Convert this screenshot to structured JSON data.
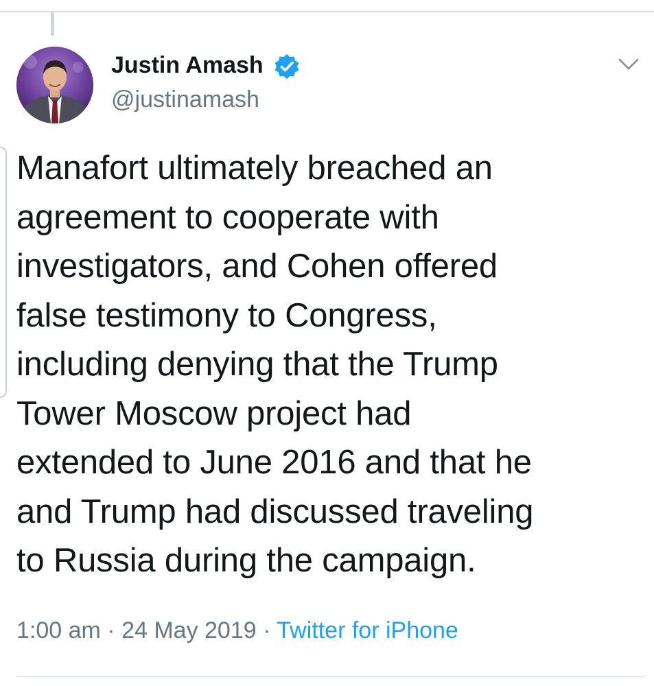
{
  "author": {
    "display_name": "Justin Amash",
    "handle": "@justinamash",
    "verified": true
  },
  "tweet": {
    "text": "Manafort ultimately breached an\nagreement to cooperate with\ninvestigators, and Cohen offered\nfalse testimony to Congress,\nincluding denying that the Trump\nTower Moscow project had\nextended to June 2016 and that he\nand Trump had discussed traveling\nto Russia during the campaign.",
    "time": "1:00 am",
    "date": "24 May 2019",
    "separator": " · ",
    "source": "Twitter for iPhone"
  },
  "icons": {
    "verified": "verified-badge-icon",
    "menu": "chevron-down-icon"
  },
  "colors": {
    "text_primary": "#14171a",
    "text_secondary": "#657786",
    "link_blue": "#1da1f2",
    "verified_blue": "#1da1f2",
    "divider": "#e1e8ed"
  }
}
